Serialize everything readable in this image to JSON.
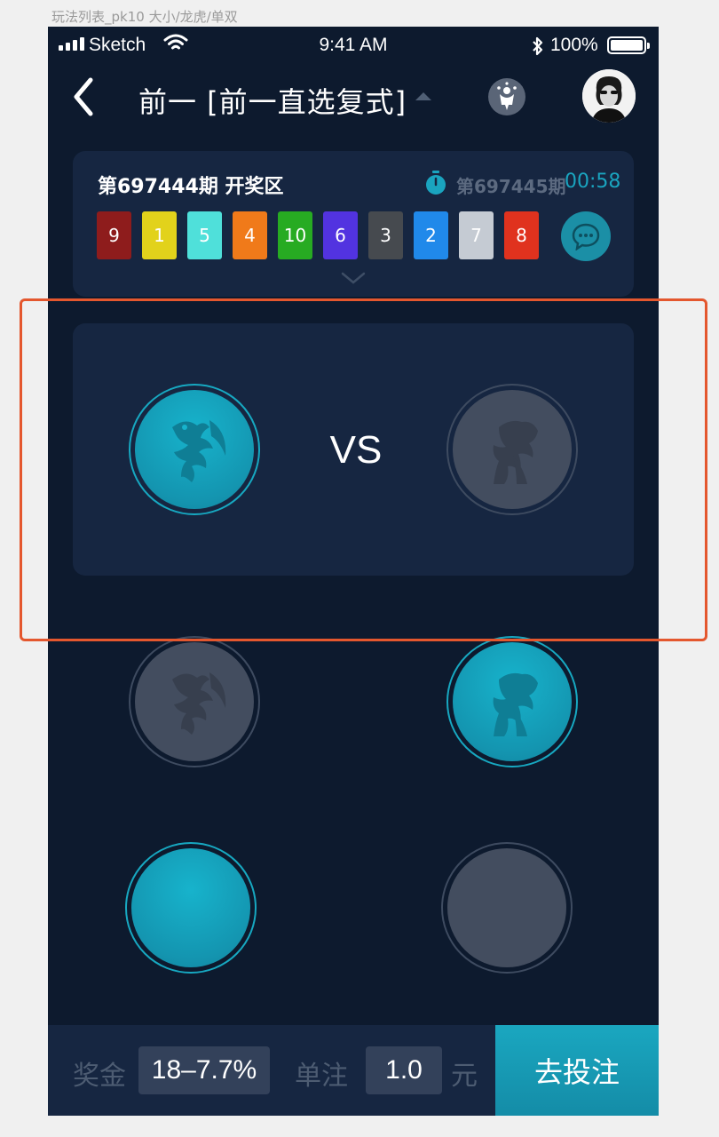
{
  "artboard": {
    "label": "玩法列表_pk10 大小/龙虎/单双"
  },
  "status_bar": {
    "carrier": "Sketch",
    "time": "9:41 AM",
    "battery": "100%"
  },
  "nav": {
    "title": "前一 [前一直选复式]"
  },
  "draw": {
    "period": "第697444期 开奖区",
    "next_period": "第697445期",
    "countdown": "00:58",
    "balls": [
      {
        "number": "9",
        "color": "#8e1c1c"
      },
      {
        "number": "1",
        "color": "#e2d21b"
      },
      {
        "number": "5",
        "color": "#4fe0da"
      },
      {
        "number": "4",
        "color": "#f07a1a"
      },
      {
        "number": "10",
        "color": "#27ab22"
      },
      {
        "number": "6",
        "color": "#5233e0"
      },
      {
        "number": "3",
        "color": "#464a4f"
      },
      {
        "number": "2",
        "color": "#2089ea"
      },
      {
        "number": "7",
        "color": "#c5cbd3"
      },
      {
        "number": "8",
        "color": "#e0321e"
      }
    ]
  },
  "vs": {
    "text": "VS"
  },
  "options": [
    {
      "name": "dragon",
      "state": "selected"
    },
    {
      "name": "tiger",
      "state": "unselected"
    },
    {
      "name": "dragon",
      "state": "unselected"
    },
    {
      "name": "tiger",
      "state": "selected"
    },
    {
      "name": "plain",
      "state": "selected"
    },
    {
      "name": "plain",
      "state": "unselected"
    }
  ],
  "bottom_bar": {
    "prize_label": "奖金",
    "prize_value": "18–7.7%",
    "unit_label": "单注",
    "amount_value": "1.0",
    "currency": "元",
    "bet_button": "去投注"
  },
  "colors": {
    "accent": "#17a8c1",
    "background": "#0d1a2e",
    "panel": "#162641",
    "highlight": "#e4572e"
  }
}
